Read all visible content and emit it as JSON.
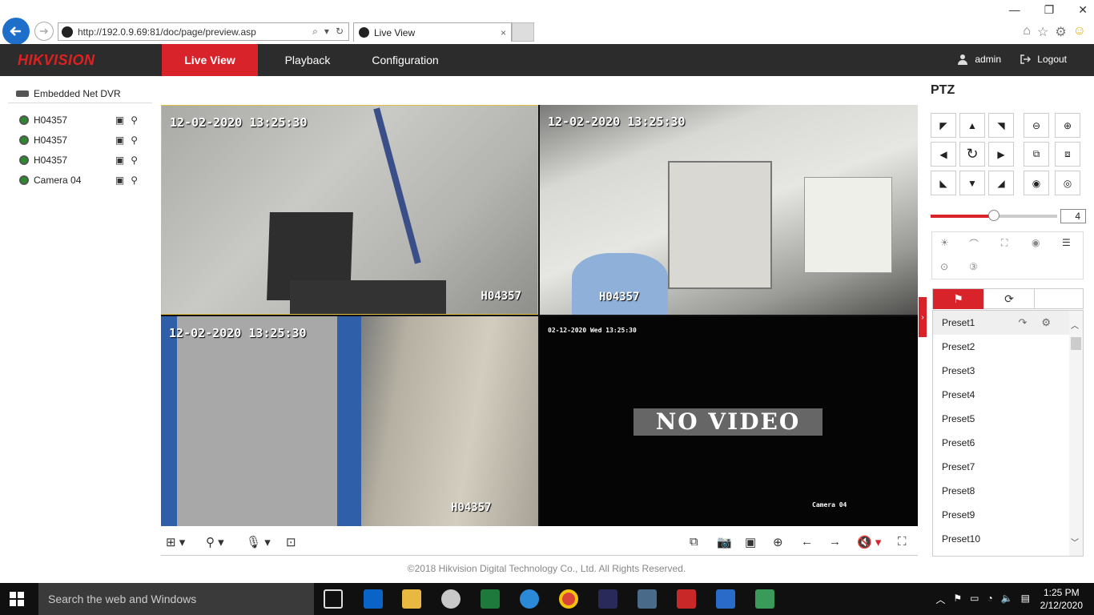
{
  "browser": {
    "url": "http://192.0.9.69:81/doc/page/preview.asp",
    "tab_title": "Live View",
    "tab_close": "×",
    "win_min": "—",
    "win_restore": "❐",
    "win_close": "✕"
  },
  "app": {
    "logo": "HIKVISION",
    "nav": [
      "Live View",
      "Playback",
      "Configuration"
    ],
    "user": "admin",
    "logout": "Logout"
  },
  "tree": {
    "root": "Embedded Net DVR",
    "cameras": [
      {
        "name": "H04357"
      },
      {
        "name": "H04357"
      },
      {
        "name": "H04357"
      },
      {
        "name": "Camera 04"
      }
    ]
  },
  "tiles": [
    {
      "time": "12-02-2020 13:25:30",
      "name": "H04357"
    },
    {
      "time": "12-02-2020 13:25:30",
      "name": "H04357"
    },
    {
      "time": "12-02-2020 13:25:30",
      "name": "H04357"
    },
    {
      "time": "02-12-2020 Wed 13:25:30",
      "name": "Camera 04",
      "message": "NO VIDEO"
    }
  ],
  "copyright": "©2018 Hikvision Digital Technology Co., Ltd. All Rights Reserved.",
  "ptz": {
    "title": "PTZ",
    "speed": "4",
    "speed_fraction": 0.5,
    "presets": [
      "Preset1",
      "Preset2",
      "Preset3",
      "Preset4",
      "Preset5",
      "Preset6",
      "Preset7",
      "Preset8",
      "Preset9",
      "Preset10"
    ],
    "selected_preset": "Preset1"
  },
  "taskbar": {
    "search": "Search the web and Windows",
    "time": "1:25 PM",
    "date": "2/12/2020"
  },
  "colors": {
    "brand_red": "#d8232a",
    "nav_bg": "#2c2c2c",
    "selected_border": "#e2c044"
  }
}
